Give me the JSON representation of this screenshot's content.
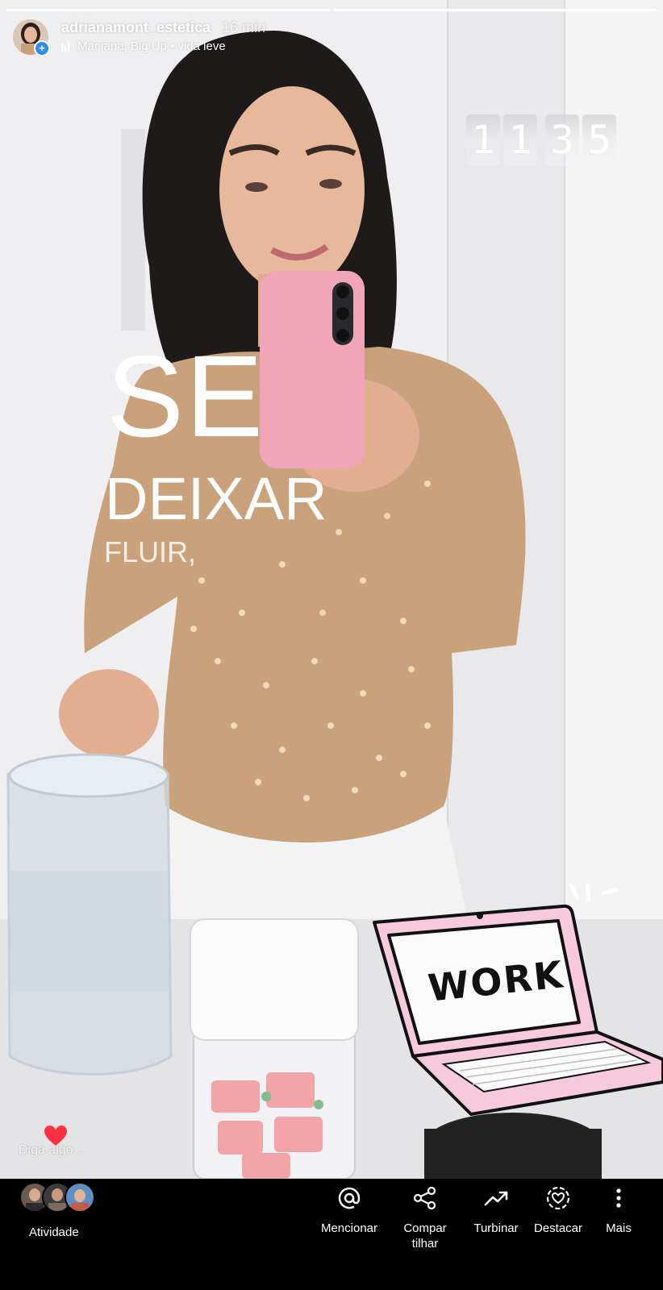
{
  "story": {
    "progress_segments": [
      1,
      1
    ],
    "username": "adrianamont_estetica",
    "time_ago": "16 min",
    "music": "Mar.iana, Big Up • vida leve",
    "clock_digits": [
      "1",
      "1",
      "3",
      "5"
    ],
    "overlay_text": {
      "line1": "SE",
      "line2": "DEIXAR",
      "line3": "FLUIR,"
    },
    "sticker_text": "WORK",
    "reply_hint": "Diga algo..."
  },
  "bottom_bar": {
    "activity_label": "Atividade",
    "actions": [
      {
        "label": "Mencionar",
        "icon": "at-icon"
      },
      {
        "label": "Compartilhar",
        "icon": "share-icon"
      },
      {
        "label": "Turbinar",
        "icon": "trending-up-icon"
      },
      {
        "label": "Destacar",
        "icon": "highlight-icon"
      },
      {
        "label": "Mais",
        "icon": "more-vertical-icon"
      }
    ]
  },
  "colors": {
    "accent_blue": "#2f8cf0",
    "heart_red": "#ff3040",
    "sweater": "#c9a27c",
    "phone_pink": "#f0a5b9",
    "laptop_pink": "#f6c9dc"
  }
}
